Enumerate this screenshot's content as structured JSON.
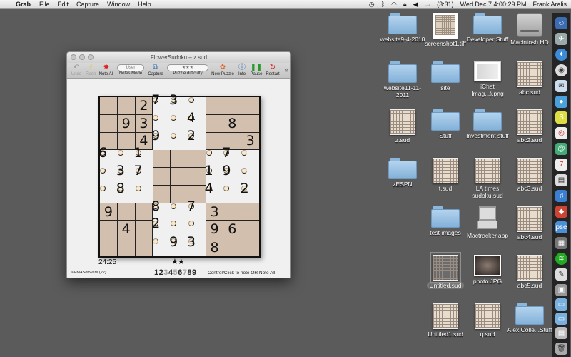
{
  "menubar": {
    "app": "Grab",
    "menus": [
      "File",
      "Edit",
      "Capture",
      "Window",
      "Help"
    ],
    "battery": "(3:31)",
    "datetime": "Wed Dec 7  4:00:29 PM",
    "user": "Frank Aralis"
  },
  "window": {
    "title": "FlowerSudoku – z.sud",
    "toolbar": {
      "undo": "Undo",
      "flash": "Flash",
      "note_all": "Note All",
      "notes_mode_value": "User",
      "notes_mode": "Notes Mode",
      "capture": "Capture",
      "difficulty_value": "★★★",
      "difficulty": "Puzzle difficulty",
      "new_puzzle": "New Puzzle",
      "info": "Info",
      "pause": "Pause",
      "restart": "Restart"
    },
    "grid": [
      [
        "",
        "",
        "2",
        "7",
        "3",
        "",
        "",
        "",
        ""
      ],
      [
        "",
        "9",
        "3",
        "",
        "",
        "4",
        "",
        "8",
        ""
      ],
      [
        "",
        "",
        "4",
        "9",
        "",
        "2",
        "",
        "",
        "3"
      ],
      [
        "6",
        "",
        "1",
        "",
        "",
        "",
        "",
        "7",
        ""
      ],
      [
        "",
        "3",
        "7",
        "",
        "",
        "",
        "1",
        "9",
        ""
      ],
      [
        "",
        "8",
        "",
        "",
        "",
        "",
        "4",
        "",
        "2"
      ],
      [
        "9",
        "",
        "",
        "8",
        "",
        "7",
        "3",
        "",
        ""
      ],
      [
        "",
        "4",
        "",
        "2",
        "",
        "",
        "9",
        "6",
        ""
      ],
      [
        "",
        "",
        "",
        "",
        "9",
        "3",
        "8",
        "",
        ""
      ]
    ],
    "timer": "24:25",
    "stars": "★★",
    "copyright": "©FMASoftware (22)",
    "digits": [
      "1",
      "2",
      "3",
      "4",
      "5",
      "6",
      "7",
      "8",
      "9"
    ],
    "digits_used": [
      false,
      false,
      true,
      false,
      true,
      false,
      true,
      false,
      false
    ],
    "hint": "Control/Click to note OR Note All"
  },
  "desktop": {
    "icons": [
      {
        "label": "website9-4-2010",
        "type": "folder"
      },
      {
        "label": "screenshot1.tiff",
        "type": "tiff"
      },
      {
        "label": "Developer Stuff",
        "type": "folder"
      },
      {
        "label": "Macintosh HD",
        "type": "hd"
      },
      {
        "label": "website11-11-2011",
        "type": "folder"
      },
      {
        "label": "site",
        "type": "folder"
      },
      {
        "label": "iChat Imag...).png",
        "type": "png"
      },
      {
        "label": "abc.sud",
        "type": "sud"
      },
      {
        "label": "z.sud",
        "type": "sud"
      },
      {
        "label": "Stuff",
        "type": "folder"
      },
      {
        "label": "Investment stuff",
        "type": "folder"
      },
      {
        "label": "abc2.sud",
        "type": "sud"
      },
      {
        "label": "zESPN",
        "type": "folder"
      },
      {
        "label": "t.sud",
        "type": "sud"
      },
      {
        "label": "LA times sudoku.sud",
        "type": "sud"
      },
      {
        "label": "abc3.sud",
        "type": "sud"
      },
      {
        "label": "test images",
        "type": "folder"
      },
      {
        "label": "Mactracker.app",
        "type": "app"
      },
      {
        "label": "abc4.sud",
        "type": "sud"
      },
      {
        "label": "Untitled.sud",
        "type": "sud"
      },
      {
        "label": "photo.JPG",
        "type": "photo"
      },
      {
        "label": "abc5.sud",
        "type": "sud"
      },
      {
        "label": "Untitled1.sud",
        "type": "sud"
      },
      {
        "label": "q.sud",
        "type": "sud"
      },
      {
        "label": "Alex Colle...Stuff",
        "type": "folder"
      }
    ]
  },
  "colors": {
    "desktop": "#5b5b5b",
    "cell_dark": "#d2bfae",
    "cell_light": "#fde6c4",
    "folder": "#9cc4e6"
  }
}
